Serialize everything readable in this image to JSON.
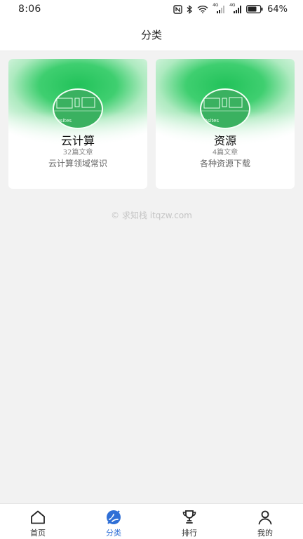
{
  "status_bar": {
    "time": "8:06",
    "battery_percent": "64%",
    "icons": [
      "nfc-icon",
      "bluetooth-icon",
      "wifi-icon",
      "signal-icon",
      "signal-icon",
      "battery-icon"
    ],
    "network_labels": [
      "4G",
      "4G"
    ]
  },
  "header": {
    "title": "分类"
  },
  "categories": [
    {
      "name": "云计算",
      "count": "32篇文章",
      "description": "云计算领域常识",
      "thumb_caption": "ebsites"
    },
    {
      "name": "资源",
      "count": "4篇文章",
      "description": "各种资源下载",
      "thumb_caption": "ebsites"
    }
  ],
  "footer": {
    "copyright": "© 求知栈 itqzw.com"
  },
  "bottom_nav": {
    "items": [
      {
        "label": "首页",
        "icon": "home-icon",
        "active": false
      },
      {
        "label": "分类",
        "icon": "category-icon",
        "active": true
      },
      {
        "label": "排行",
        "icon": "trophy-icon",
        "active": false
      },
      {
        "label": "我的",
        "icon": "user-icon",
        "active": false
      }
    ]
  },
  "colors": {
    "accent": "#2f6fd6",
    "card_green": "#22c25a",
    "background": "#f2f2f2"
  }
}
